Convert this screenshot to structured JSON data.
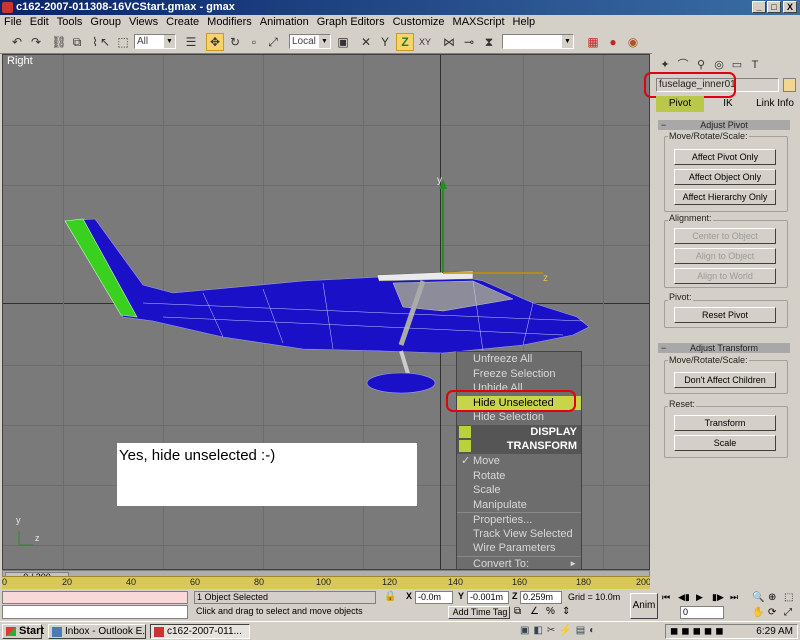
{
  "window": {
    "title": "c162-2007-011308-16VCStart.gmax - gmax",
    "min": "_",
    "max": "□",
    "close": "X"
  },
  "menu": [
    "File",
    "Edit",
    "Tools",
    "Group",
    "Views",
    "Create",
    "Modifiers",
    "Animation",
    "Graph Editors",
    "Customize",
    "MAXScript",
    "Help"
  ],
  "toolbar": {
    "filter_value": "All",
    "coord_value": "Local",
    "named_sel_value": ""
  },
  "viewport": {
    "label": "Right",
    "axis_x": "z",
    "axis_y": "y",
    "gizmo_x": "z",
    "gizmo_y": "y"
  },
  "annotation": {
    "text": "Yes, hide unselected :-)"
  },
  "context_menu": {
    "items": [
      {
        "label": "Unfreeze All"
      },
      {
        "label": "Freeze Selection"
      },
      {
        "label": "Unhide All"
      },
      {
        "label": "Hide Unselected"
      },
      {
        "label": "Hide Selection"
      },
      {
        "label": "DISPLAY"
      },
      {
        "label": "TRANSFORM"
      },
      {
        "label": "Move",
        "checked": "✓"
      },
      {
        "label": "Rotate"
      },
      {
        "label": "Scale"
      },
      {
        "label": "Manipulate"
      },
      {
        "label": "Properties..."
      },
      {
        "label": "Track View Selected"
      },
      {
        "label": "Wire Parameters"
      },
      {
        "label": "Convert To:",
        "arrow": "►"
      }
    ]
  },
  "command_panel": {
    "object_name": "fuselage_inner01",
    "object_color": "#f0d890",
    "subtabs": [
      "Pivot",
      "IK",
      "Link Info"
    ],
    "adjust_pivot": {
      "title": "Adjust Pivot",
      "move_group": "Move/Rotate/Scale:",
      "buttons": [
        "Affect Pivot Only",
        "Affect Object Only",
        "Affect Hierarchy Only"
      ],
      "alignment_group": "Alignment:",
      "align_buttons": [
        "Center to Object",
        "Align to Object",
        "Align to World"
      ],
      "pivot_group": "Pivot:",
      "reset_pivot": "Reset Pivot"
    },
    "adjust_transform": {
      "title": "Adjust Transform",
      "move_group": "Move/Rotate/Scale:",
      "dont_affect": "Don't Affect Children",
      "reset_group": "Reset:",
      "transform": "Transform",
      "scale": "Scale"
    }
  },
  "timeline": {
    "slider": "0 / 200",
    "ticks": [
      "0",
      "20",
      "40",
      "60",
      "80",
      "100",
      "120",
      "140",
      "160",
      "180",
      "200"
    ]
  },
  "status": {
    "selection": "1 Object Selected",
    "prompt": "Click and drag to select and move objects",
    "x_label": "X",
    "x_value": "-0.0m",
    "y_label": "Y",
    "y_value": "-0.001m",
    "z_label": "Z",
    "z_value": "0.259m",
    "grid": "Grid = 10.0m",
    "add_time_tag": "Add Time Tag",
    "anim": "Anim",
    "frame": "0"
  },
  "taskbar": {
    "start": "Start",
    "tasks": [
      "Inbox - Outlook E...",
      "c162-2007-011..."
    ],
    "clock": "6:29 AM"
  },
  "colors": {
    "highlight": "#e00010",
    "menu_hl": "#c8d44a",
    "model": "#1a10c8",
    "tail": "#3ad020"
  }
}
